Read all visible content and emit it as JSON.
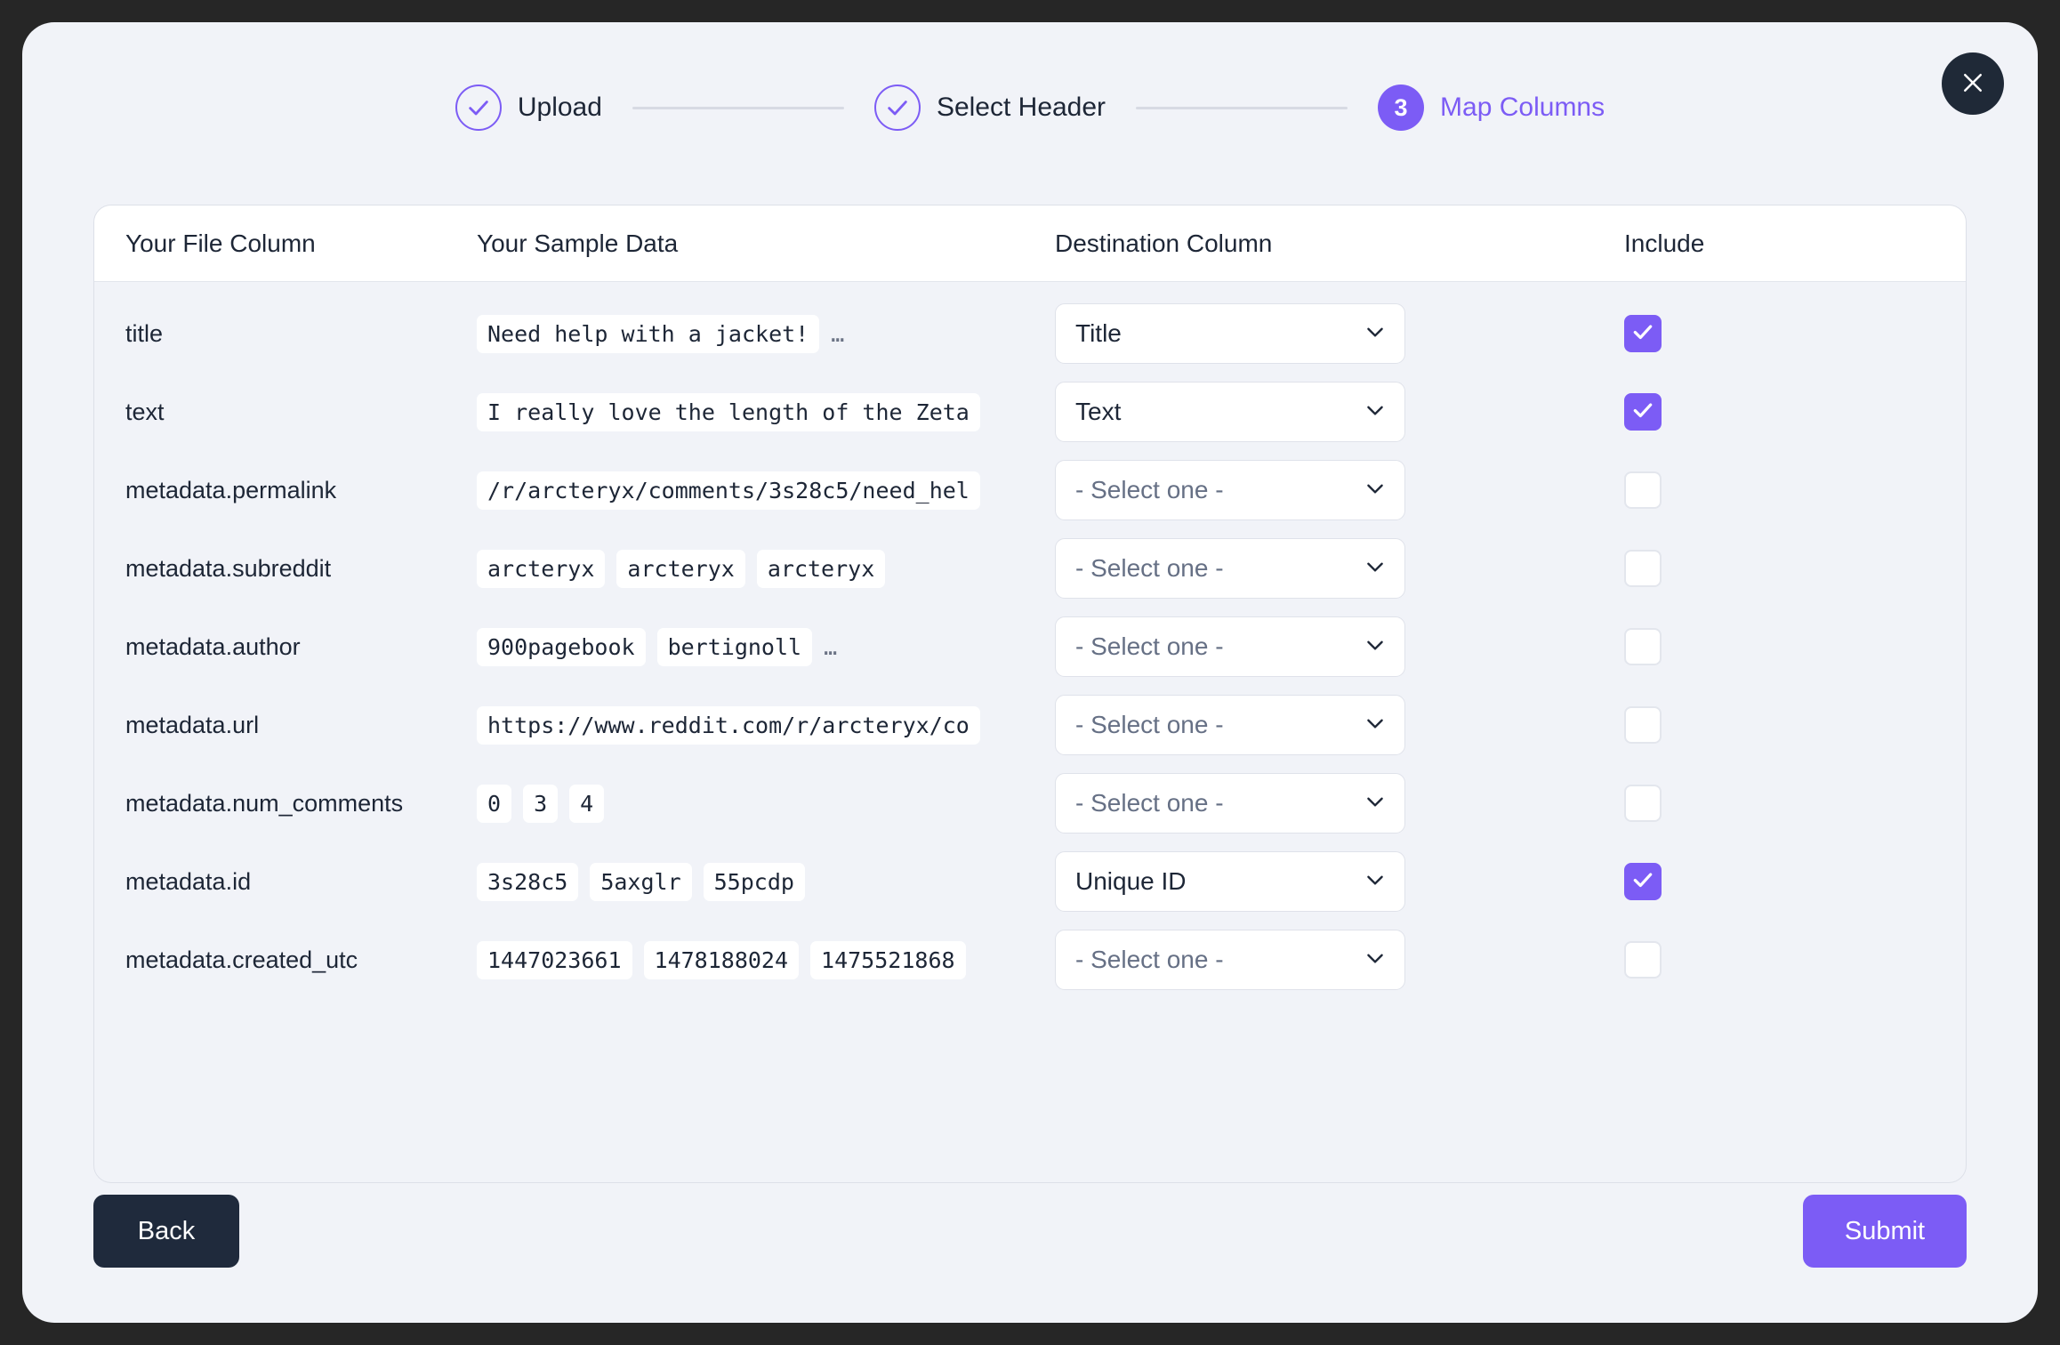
{
  "modal": {
    "close_icon": "close-icon"
  },
  "stepper": {
    "steps": [
      {
        "label": "Upload",
        "state": "done",
        "icon": "check-icon"
      },
      {
        "label": "Select Header",
        "state": "done",
        "icon": "check-icon"
      },
      {
        "label": "Map Columns",
        "state": "active",
        "number": "3"
      }
    ]
  },
  "table": {
    "headers": {
      "file_column": "Your File Column",
      "sample_data": "Your Sample Data",
      "destination_column": "Destination Column",
      "include": "Include"
    },
    "select_placeholder": "- Select one -",
    "rows": [
      {
        "file_column": "title",
        "samples": [
          "Need help with a jacket!"
        ],
        "truncated": true,
        "destination": "Title",
        "destination_is_placeholder": false,
        "include": true
      },
      {
        "file_column": "text",
        "samples": [
          "I really love the length of the Zeta"
        ],
        "truncated": false,
        "destination": "Text",
        "destination_is_placeholder": false,
        "include": true
      },
      {
        "file_column": "metadata.permalink",
        "samples": [
          "/r/arcteryx/comments/3s28c5/need_hel"
        ],
        "truncated": false,
        "destination": "- Select one -",
        "destination_is_placeholder": true,
        "include": false
      },
      {
        "file_column": "metadata.subreddit",
        "samples": [
          "arcteryx",
          "arcteryx",
          "arcteryx"
        ],
        "truncated": false,
        "destination": "- Select one -",
        "destination_is_placeholder": true,
        "include": false
      },
      {
        "file_column": "metadata.author",
        "samples": [
          "900pagebook",
          "bertignoll"
        ],
        "truncated": true,
        "destination": "- Select one -",
        "destination_is_placeholder": true,
        "include": false
      },
      {
        "file_column": "metadata.url",
        "samples": [
          "https://www.reddit.com/r/arcteryx/co"
        ],
        "truncated": false,
        "destination": "- Select one -",
        "destination_is_placeholder": true,
        "include": false
      },
      {
        "file_column": "metadata.num_comments",
        "samples": [
          "0",
          "3",
          "4"
        ],
        "truncated": false,
        "destination": "- Select one -",
        "destination_is_placeholder": true,
        "include": false
      },
      {
        "file_column": "metadata.id",
        "samples": [
          "3s28c5",
          "5axglr",
          "55pcdp"
        ],
        "truncated": false,
        "destination": "Unique ID",
        "destination_is_placeholder": false,
        "include": true
      },
      {
        "file_column": "metadata.created_utc",
        "samples": [
          "1447023661",
          "1478188024",
          "1475521868"
        ],
        "truncated": false,
        "destination": "- Select one -",
        "destination_is_placeholder": true,
        "include": false
      }
    ]
  },
  "footer": {
    "back_label": "Back",
    "submit_label": "Submit"
  },
  "colors": {
    "accent": "#7c5cf5",
    "dark": "#1f2a3c",
    "page_background": "#262626",
    "modal_background": "#f1f3f8"
  }
}
